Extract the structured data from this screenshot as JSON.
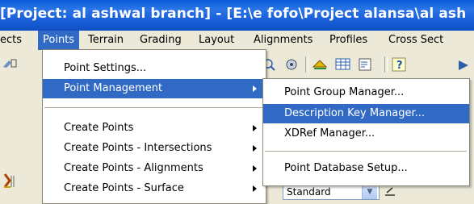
{
  "window": {
    "title": "[Project: al ashwal branch] - [E:\\e fofo\\Project alansa\\al ash"
  },
  "menubar": {
    "items": [
      "ects",
      "Points",
      "Terrain",
      "Grading",
      "Layout",
      "Alignments",
      "Profiles",
      "Cross Sect"
    ]
  },
  "points_menu": {
    "items": [
      "Point Settings...",
      "Point Management",
      "Create Points",
      "Create Points - Intersections",
      "Create Points - Alignments",
      "Create Points - Surface"
    ]
  },
  "point_management_menu": {
    "items": [
      "Point Group Manager...",
      "Description Key Manager...",
      "XDRef Manager...",
      "Point Database Setup..."
    ]
  },
  "toolbar": {
    "combo_value": "Standard"
  },
  "colors": {
    "highlight": "#316ac5",
    "titlebar": "#0a5bd8",
    "menu_bg": "#ece9d8"
  }
}
